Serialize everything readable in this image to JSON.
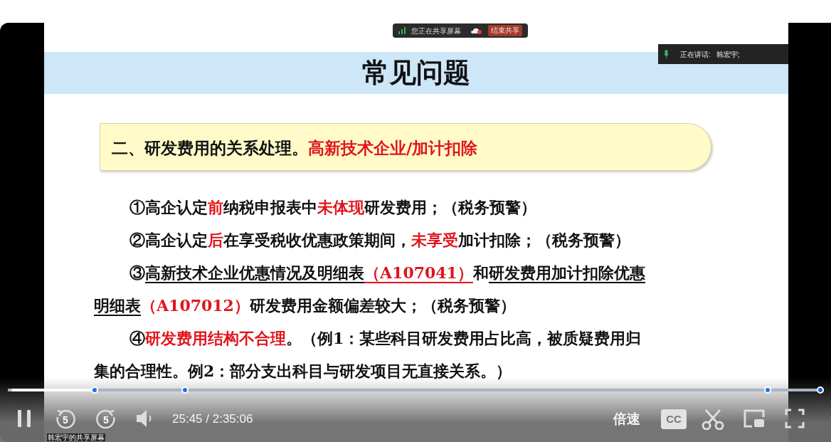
{
  "share_bar": {
    "status": "您正在共享屏幕",
    "stop_button": "结束共享"
  },
  "speaker": {
    "label": "正在讲话:",
    "name": "韩宏宇;"
  },
  "slide": {
    "title": "常见问题",
    "subtitle": [
      {
        "text": "二、研发费用的关系处理。",
        "kind": "plain"
      },
      {
        "text": "高新技术企业/加计扣除",
        "kind": "red"
      }
    ],
    "paragraphs": [
      [
        {
          "text": "①高企认定",
          "kind": "plain"
        },
        {
          "text": "前",
          "kind": "red"
        },
        {
          "text": "纳税申报表中",
          "kind": "plain"
        },
        {
          "text": "未体现",
          "kind": "red"
        },
        {
          "text": "研发费用；（税务预警）",
          "kind": "plain"
        }
      ],
      [
        {
          "text": "②高企认定",
          "kind": "plain"
        },
        {
          "text": "后",
          "kind": "red"
        },
        {
          "text": "在享受税收优惠政策期间，",
          "kind": "plain"
        },
        {
          "text": "未享受",
          "kind": "red"
        },
        {
          "text": "加计扣除；（税务预警）",
          "kind": "plain"
        }
      ],
      [
        {
          "text": "③",
          "kind": "plain"
        },
        {
          "text": "高新技术企业优惠情况及明细表",
          "kind": "underline"
        },
        {
          "text": "（A107041）",
          "kind": "red-underline"
        },
        {
          "text": "和",
          "kind": "plain"
        },
        {
          "text": "研发费用加计扣除优惠明细表",
          "kind": "underline"
        },
        {
          "text": "（A107012）",
          "kind": "red"
        },
        {
          "text": "研发费用金额偏差较大；（税务预警）",
          "kind": "plain"
        }
      ],
      [
        {
          "text": "④",
          "kind": "plain"
        },
        {
          "text": "研发费用结构不合理",
          "kind": "red"
        },
        {
          "text": "。（例1：某些科目研发费用占比高，被质疑费用归集的合理性。例2：部分支出科目与研发项目无直接关系。）",
          "kind": "plain"
        }
      ]
    ]
  },
  "player": {
    "progress": {
      "level": 0.103
    },
    "markers": [
      {
        "level": 0.215
      },
      {
        "level": 0.935
      }
    ],
    "playing": true,
    "rewind_label": "5",
    "forward_label": "5",
    "time": "25:45 / 2:35:06",
    "speed_button": "倍速",
    "cc_button": "CC",
    "source_label": "韩宏宇的共享屏幕"
  }
}
